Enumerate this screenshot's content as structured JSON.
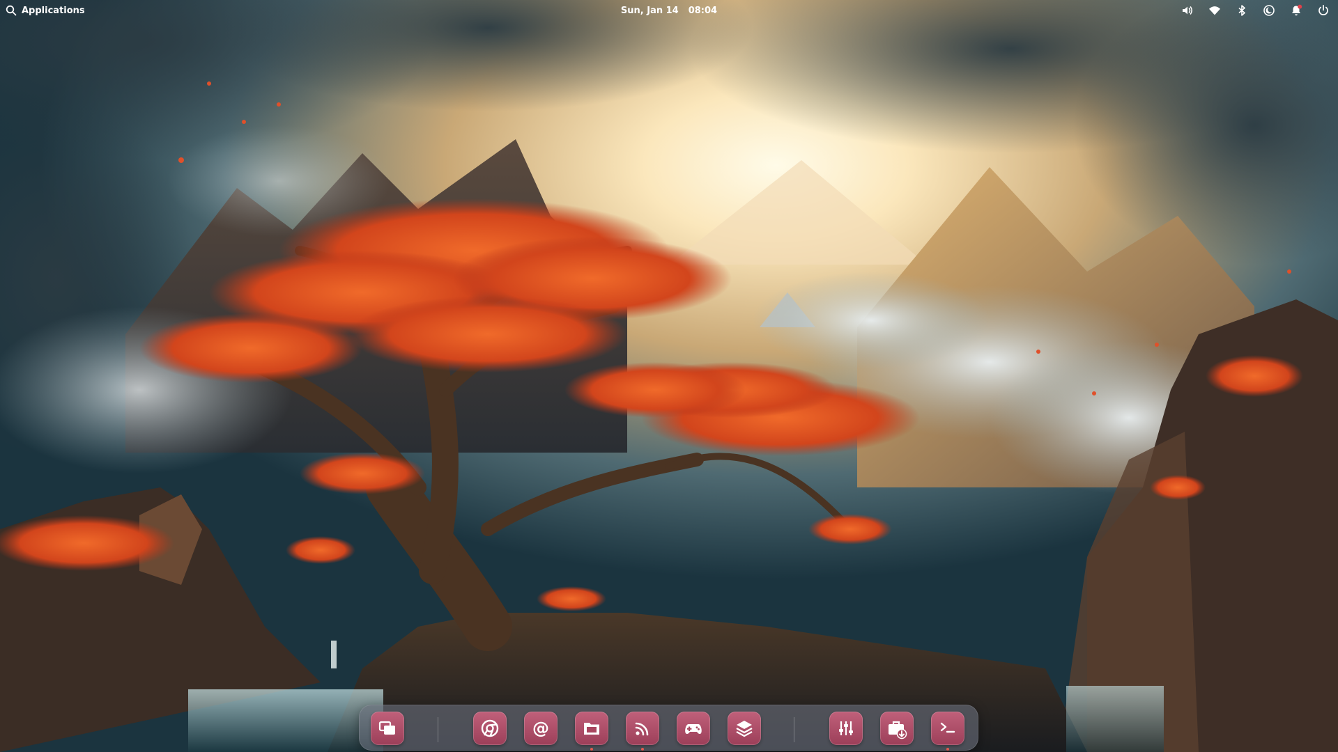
{
  "top_panel": {
    "applications_label": "Applications",
    "date": "Sun, Jan 14",
    "time": "08:04",
    "indicators": [
      {
        "icon": "volume-icon"
      },
      {
        "icon": "wifi-icon"
      },
      {
        "icon": "bluetooth-icon"
      },
      {
        "icon": "night-light-icon"
      },
      {
        "icon": "notifications-icon"
      },
      {
        "icon": "power-icon"
      }
    ]
  },
  "dock": {
    "items": [
      {
        "icon": "multitasking-view-icon",
        "running": false
      },
      {
        "icon": "web-browser-icon",
        "running": false
      },
      {
        "icon": "mail-icon",
        "running": false
      },
      {
        "icon": "files-icon",
        "running": true
      },
      {
        "icon": "podcasts-icon",
        "running": true
      },
      {
        "icon": "games-icon",
        "running": false
      },
      {
        "icon": "layers-app-icon",
        "running": false
      },
      {
        "icon": "settings-sliders-icon",
        "running": false
      },
      {
        "icon": "app-center-icon",
        "running": false
      },
      {
        "icon": "terminal-icon",
        "running": true
      }
    ]
  },
  "colors": {
    "dock_icon_bg": "#b0506b",
    "notification_badge": "#e0404a",
    "running_indicator": "#e05a50"
  }
}
